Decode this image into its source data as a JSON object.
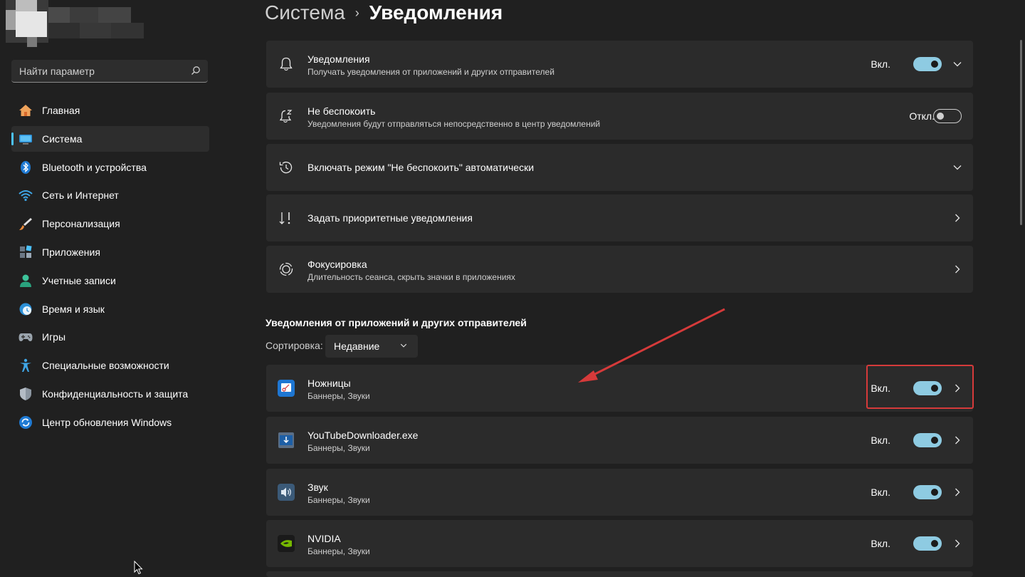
{
  "search": {
    "placeholder": "Найти параметр"
  },
  "sidebar": {
    "items": [
      {
        "label": "Главная",
        "icon": "home-icon"
      },
      {
        "label": "Система",
        "icon": "system-icon",
        "active": true
      },
      {
        "label": "Bluetooth и устройства",
        "icon": "bluetooth-icon"
      },
      {
        "label": "Сеть и Интернет",
        "icon": "wifi-icon"
      },
      {
        "label": "Персонализация",
        "icon": "brush-icon"
      },
      {
        "label": "Приложения",
        "icon": "apps-icon"
      },
      {
        "label": "Учетные записи",
        "icon": "user-icon"
      },
      {
        "label": "Время и язык",
        "icon": "clock-globe-icon"
      },
      {
        "label": "Игры",
        "icon": "gamepad-icon"
      },
      {
        "label": "Специальные возможности",
        "icon": "accessibility-icon"
      },
      {
        "label": "Конфиденциальность и защита",
        "icon": "shield-icon"
      },
      {
        "label": "Центр обновления Windows",
        "icon": "update-icon"
      }
    ]
  },
  "breadcrumb": {
    "parent": "Система",
    "separator": "›",
    "current": "Уведомления"
  },
  "settings": [
    {
      "title": "Уведомления",
      "description": "Получать уведомления от приложений и других отправителей",
      "state": "Вкл.",
      "toggle": "on",
      "chevron": "down",
      "icon": "bell-icon"
    },
    {
      "title": "Не беспокоить",
      "description": "Уведомления будут отправляться непосредственно в центр уведомлений",
      "state": "Откл.",
      "toggle": "off",
      "icon": "bell-snooze-icon"
    },
    {
      "title": "Включать режим \"Не беспокоить\" автоматически",
      "chevron": "down",
      "icon": "clock-icon"
    },
    {
      "title": "Задать приоритетные уведомления",
      "chevron": "right",
      "icon": "priority-icon"
    },
    {
      "title": "Фокусировка",
      "description": "Длительность сеанса, скрыть значки в приложениях",
      "chevron": "right",
      "icon": "focus-icon"
    }
  ],
  "apps_section": {
    "title": "Уведомления от приложений и других отправителей",
    "sort_label": "Сортировка:",
    "sort_value": "Недавние",
    "apps": [
      {
        "name": "Ножницы",
        "description": "Баннеры, Звуки",
        "state": "Вкл.",
        "toggle": "on",
        "icon": "snipping-tool-icon"
      },
      {
        "name": "YouTubeDownloader.exe",
        "description": "Баннеры, Звуки",
        "state": "Вкл.",
        "toggle": "on",
        "icon": "app-window-icon"
      },
      {
        "name": "Звук",
        "description": "Баннеры, Звуки",
        "state": "Вкл.",
        "toggle": "on",
        "icon": "speaker-icon"
      },
      {
        "name": "NVIDIA",
        "description": "Баннеры, Звуки",
        "state": "Вкл.",
        "toggle": "on",
        "icon": "nvidia-icon"
      }
    ]
  },
  "colors": {
    "background": "#202020",
    "card": "#2b2b2b",
    "accent": "#4cc2ff",
    "toggle_on": "#8ecbe2",
    "annotation": "#d63a3a"
  }
}
